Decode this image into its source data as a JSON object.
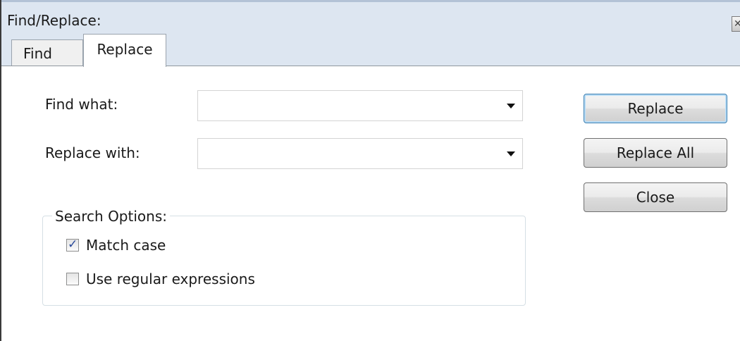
{
  "window": {
    "title": "Find/Replace:",
    "close_icon": "close-icon"
  },
  "tabs": [
    {
      "label": "Find",
      "active": false
    },
    {
      "label": "Replace",
      "active": true
    }
  ],
  "fields": {
    "find_label": "Find what:",
    "find_value": "",
    "replace_label": "Replace with:",
    "replace_value": ""
  },
  "buttons": {
    "replace": "Replace",
    "replace_all": "Replace All",
    "close": "Close"
  },
  "search_options": {
    "legend": "Search Options:",
    "match_case": {
      "label": "Match case",
      "checked": true
    },
    "regex": {
      "label": "Use regular expressions",
      "checked": false
    }
  },
  "colors": {
    "titlebar": "#dde6f1",
    "default_button_border": "#3c7fb1",
    "checkmark": "#2a4a9a"
  }
}
